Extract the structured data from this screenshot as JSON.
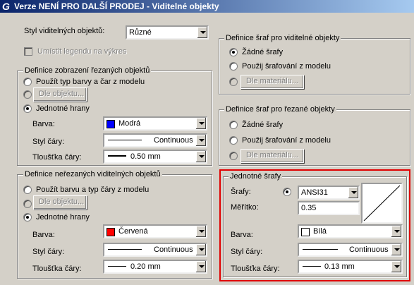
{
  "window": {
    "title": "Verze NENÍ PRO DALŠÍ PRODEJ - Viditelné objekty"
  },
  "left": {
    "style_label": "Styl viditelných objektů:",
    "style_value": "Různé",
    "legend_label": "Umístit legendu na výkres",
    "cut": {
      "title": "Definice zobrazení řezaných objektů",
      "opt_use_type": "Použít typ barvy a čar z modelu",
      "by_object_btn": "Dle objektu...",
      "opt_single": "Jednotné hrany",
      "color_label": "Barva:",
      "color_value": "Modrá",
      "color_hex": "#0000ff",
      "linestyle_label": "Styl čáry:",
      "linestyle_value": "Continuous",
      "thickness_label": "Tloušťka čáry:",
      "thickness_value": "0.50 mm"
    },
    "uncut": {
      "title": "Definice neřezaných viditelných objektů",
      "opt_use_color": "Použít barvu a typ čáry z modelu",
      "by_object_btn": "Dle objektu...",
      "opt_single": "Jednotné hrany",
      "color_label": "Barva:",
      "color_value": "Červená",
      "color_hex": "#ff0000",
      "linestyle_label": "Styl čáry:",
      "linestyle_value": "Continuous",
      "thickness_label": "Tloušťka čáry:",
      "thickness_value": "0.20 mm"
    }
  },
  "right": {
    "visible": {
      "title": "Definice šraf pro viditelné objekty",
      "opt_none": "Žádné šrafy",
      "opt_model": "Použij šrafování z modelu",
      "by_material_btn": "Dle materiálu..."
    },
    "cut": {
      "title": "Definice šraf pro řezané objekty",
      "opt_none": "Žádné šrafy",
      "opt_model": "Použij šrafování z modelu",
      "by_material_btn": "Dle materiálu..."
    },
    "uniform": {
      "title": "Jednotné šrafy",
      "hatch_label": "Šrafy:",
      "hatch_value": "ANSI31",
      "scale_label": "Měřítko:",
      "scale_value": "0.35",
      "color_label": "Barva:",
      "color_value": "Bílá",
      "color_hex": "#ffffff",
      "linestyle_label": "Styl čáry:",
      "linestyle_value": "Continuous",
      "thickness_label": "Tloušťka čáry:",
      "thickness_value": "0.13 mm",
      "highlight_color": "#e00000"
    }
  }
}
